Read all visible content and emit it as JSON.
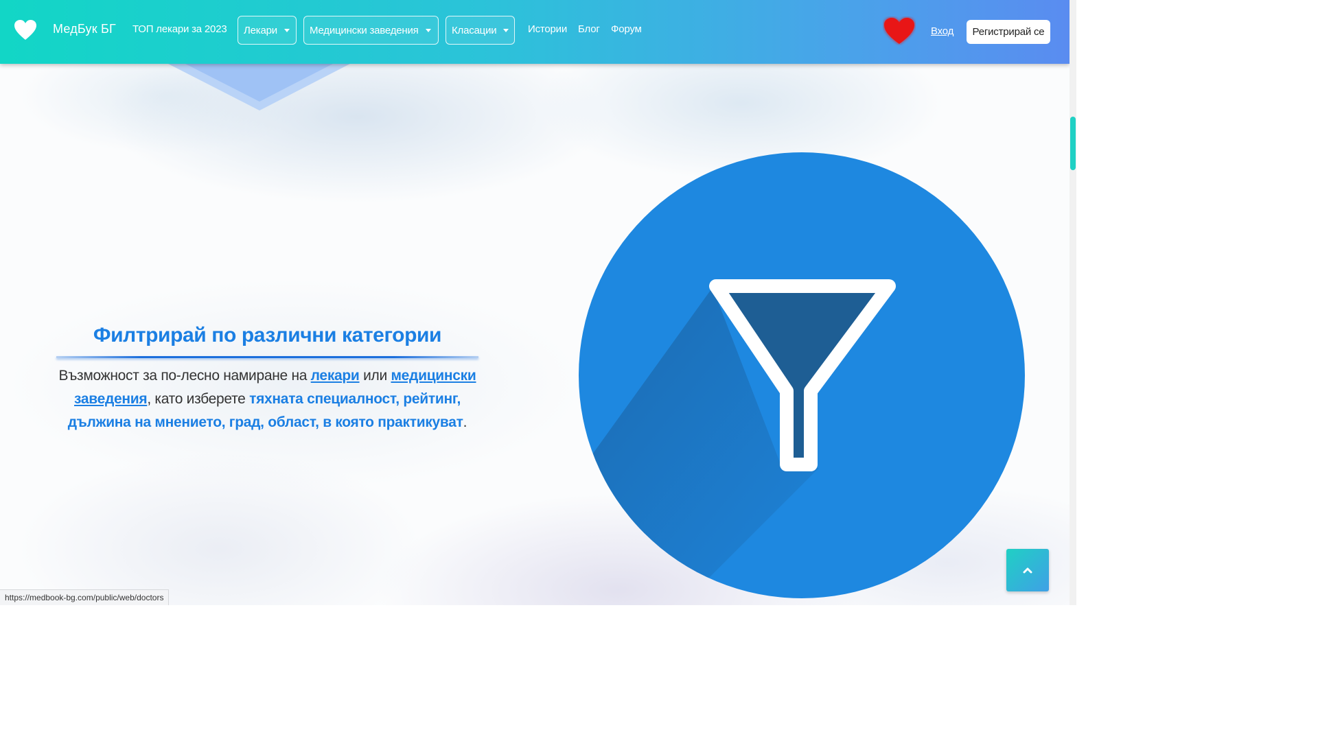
{
  "header": {
    "brand_name": "МедБук БГ",
    "top_doctors": "ТОП лекари за 2023",
    "dropdowns": [
      {
        "label": "Лекари"
      },
      {
        "label": "Медицински заведения"
      },
      {
        "label": "Класации"
      }
    ],
    "links": [
      "Истории",
      "Блог",
      "Форум"
    ],
    "login": "Вход",
    "register": "Регистрирай се"
  },
  "feature": {
    "title": "Филтрирай по различни категории",
    "desc_1": "Възможност за по-лесно намиране на ",
    "link_doctors": "лекари",
    "desc_2": " или ",
    "link_facilities": "медицински заведения",
    "desc_3": ", като изберете ",
    "highlight": "тяхната специалност, рейтинг, дължина на мнението, град, област, в която практикуват",
    "desc_4": "."
  },
  "status_bar": {
    "url": "https://medbook-bg.com/public/web/doctors"
  },
  "icons": {
    "brand": "heart-icon",
    "favorites": "heart-icon",
    "feature": "filter-funnel-icon",
    "back_to_top": "chevron-up-icon"
  },
  "colors": {
    "accent": "#1b7fe3",
    "nav_gradient_start": "#12d6c6",
    "nav_gradient_end": "#5a8cf0",
    "heart": "#e81818",
    "circle": "#1e88e0"
  }
}
